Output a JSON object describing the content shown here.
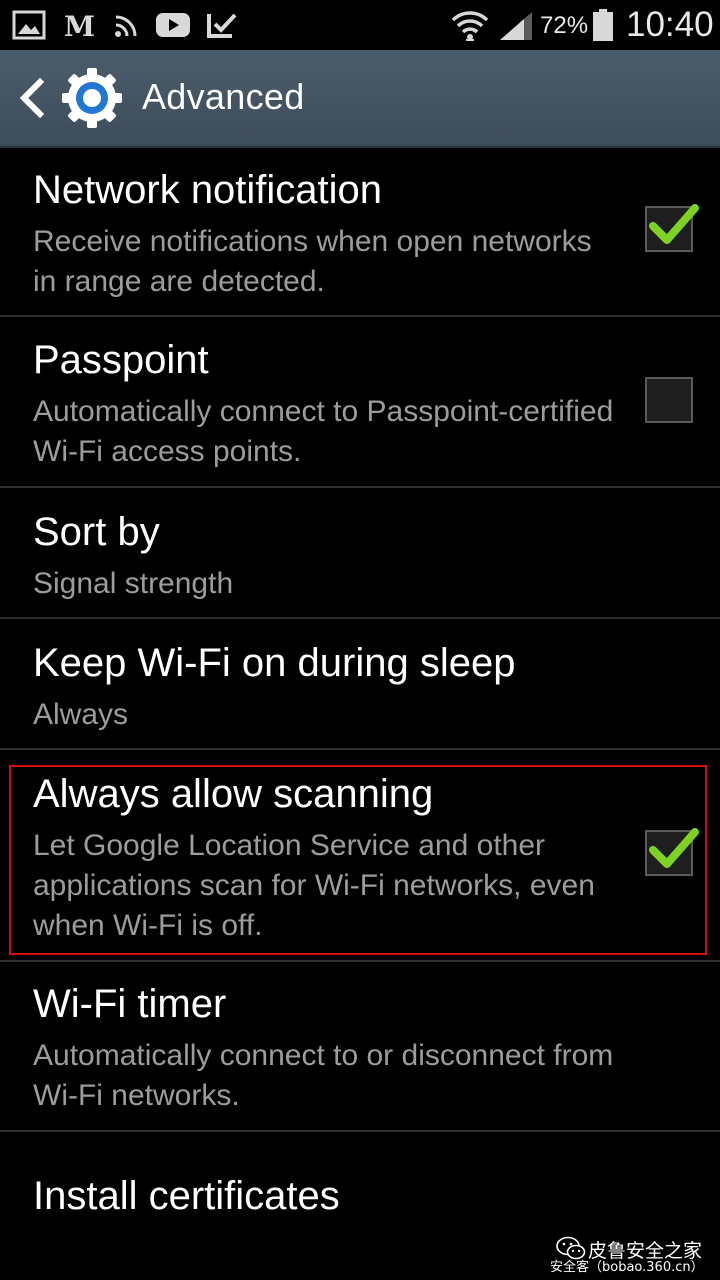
{
  "status_bar": {
    "battery": "72%",
    "time": "10:40",
    "left_icons": [
      "gallery-icon",
      "news-icon",
      "rss-icon",
      "youtube-icon",
      "task-icon"
    ],
    "right_icons": [
      "wifi-icon",
      "signal-icon",
      "battery-icon"
    ]
  },
  "action_bar": {
    "title": "Advanced",
    "icons": [
      "back-icon",
      "settings-gear-icon"
    ]
  },
  "settings": {
    "items": [
      {
        "title": "Network notification",
        "summary": "Receive notifications when open networks in range are detected.",
        "checkbox": true,
        "checked": true
      },
      {
        "title": "Passpoint",
        "summary": "Automatically connect to Passpoint-certified Wi-Fi access points.",
        "checkbox": true,
        "checked": false
      },
      {
        "title": "Sort by",
        "summary": "Signal strength"
      },
      {
        "title": "Keep Wi-Fi on during sleep",
        "summary": "Always"
      },
      {
        "title": "Always allow scanning",
        "summary": "Let Google Location Service and other applications scan for Wi-Fi networks, even when Wi-Fi is off.",
        "checkbox": true,
        "checked": true,
        "highlighted": true
      },
      {
        "title": "Wi-Fi timer",
        "summary": "Automatically connect to or disconnect from Wi-Fi networks."
      },
      {
        "title": "Install certificates"
      }
    ]
  },
  "colors": {
    "action_bar": "#44535f",
    "check_mark": "#7ed321",
    "highlight_border": "#d01010",
    "summary_text": "#9c9c9c"
  },
  "watermark": {
    "line1": "皮鲁安全之家",
    "line2": "安全客（bobao.360.cn）"
  }
}
